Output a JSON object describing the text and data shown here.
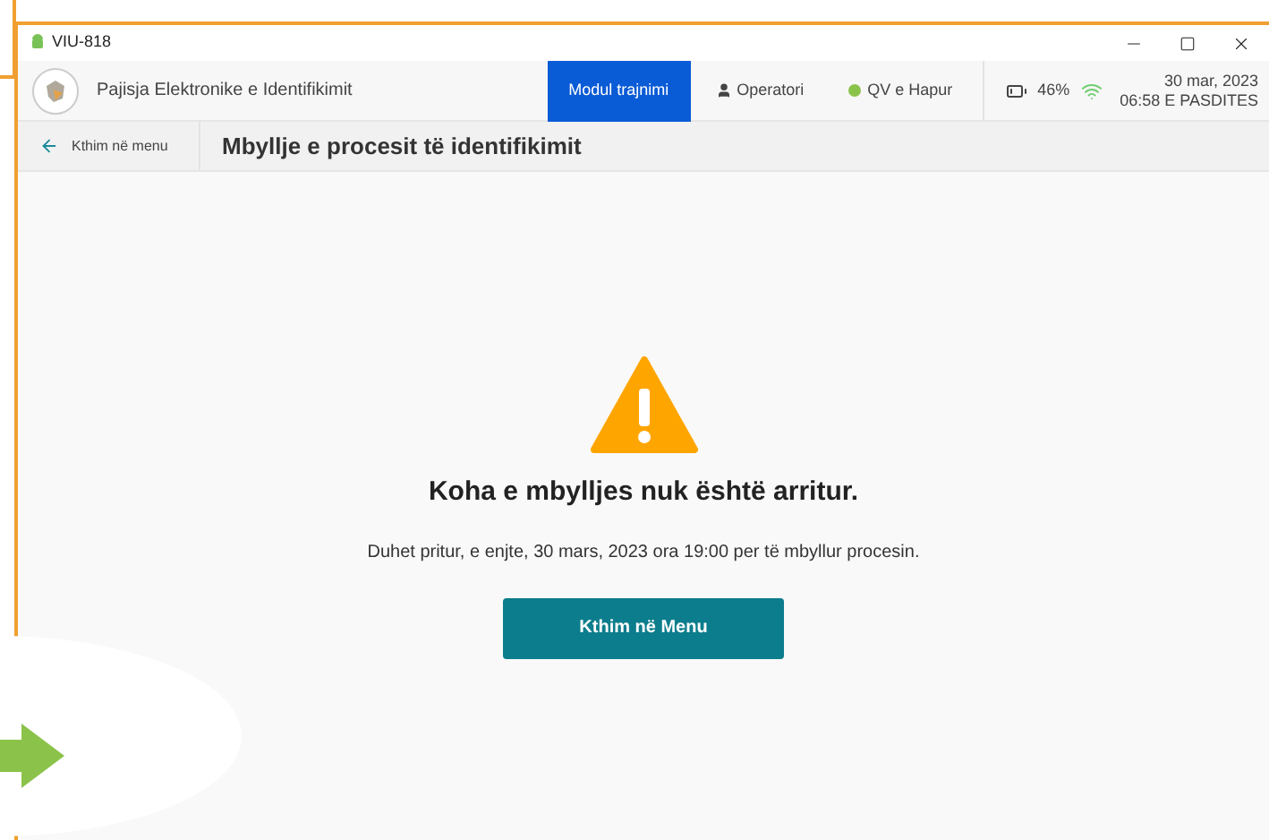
{
  "window": {
    "title": "VIU-818"
  },
  "header": {
    "app_name": "Pajisja Elektronike e Identifikimit",
    "mode": "Modul trajnimi",
    "operator": "Operatori",
    "status": {
      "label": "QV e Hapur",
      "color": "#8bc34a"
    },
    "battery": "46%",
    "date": "30 mar, 2023",
    "time": "06:58 E PASDITES"
  },
  "subheader": {
    "back": "Kthim në menu",
    "title": "Mbyllje e procesit të identifikimit"
  },
  "message": {
    "heading": "Koha e mbylljes nuk është arritur.",
    "body": "Duhet pritur, e enjte, 30 mars, 2023 ora 19:00 per të mbyllur procesin.",
    "button": "Kthim në Menu"
  }
}
